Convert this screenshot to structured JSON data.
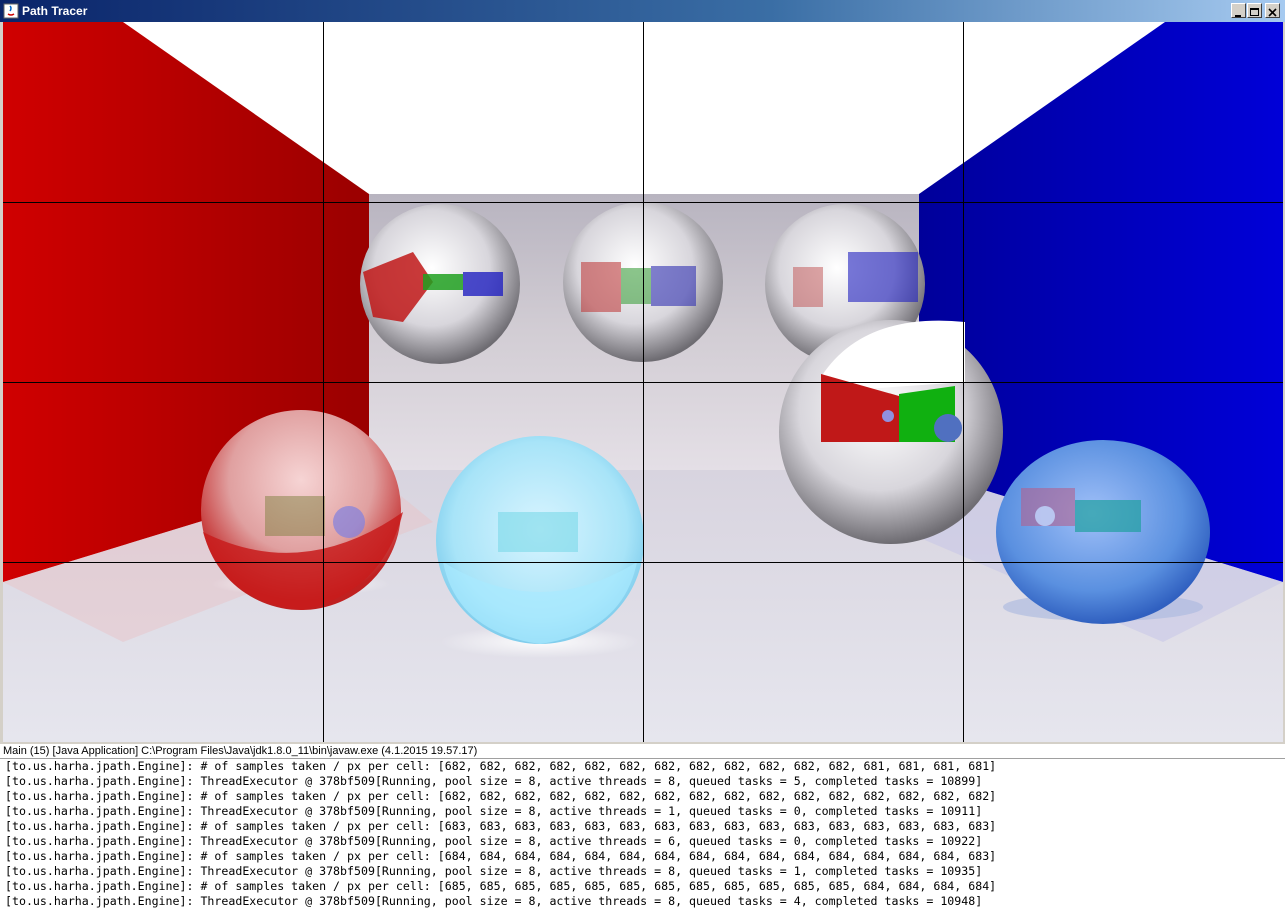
{
  "window": {
    "title": "Path Tracer",
    "buttons": [
      "minimize",
      "maximize",
      "close"
    ]
  },
  "render_view": {
    "grid_rows": 4,
    "grid_cols": 4,
    "colors": {
      "left_wall": "#cc0000",
      "right_wall": "#0000cc",
      "back_wall": "#c8c4d0",
      "floor": "#dcdbe6",
      "ceiling": "#ffffff",
      "grid_line": "#000000"
    }
  },
  "console": {
    "header": "Main (15) [Java Application] C:\\Program Files\\Java\\jdk1.8.0_11\\bin\\javaw.exe (4.1.2015 19.57.17)",
    "lines": [
      "[to.us.harha.jpath.Engine]: # of samples taken / px per cell: [682, 682, 682, 682, 682, 682, 682, 682, 682, 682, 682, 682, 681, 681, 681, 681]",
      "[to.us.harha.jpath.Engine]: ThreadExecutor @ 378bf509[Running, pool size = 8, active threads = 8, queued tasks = 5, completed tasks = 10899]",
      "[to.us.harha.jpath.Engine]: # of samples taken / px per cell: [682, 682, 682, 682, 682, 682, 682, 682, 682, 682, 682, 682, 682, 682, 682, 682]",
      "[to.us.harha.jpath.Engine]: ThreadExecutor @ 378bf509[Running, pool size = 8, active threads = 1, queued tasks = 0, completed tasks = 10911]",
      "[to.us.harha.jpath.Engine]: # of samples taken / px per cell: [683, 683, 683, 683, 683, 683, 683, 683, 683, 683, 683, 683, 683, 683, 683, 683]",
      "[to.us.harha.jpath.Engine]: ThreadExecutor @ 378bf509[Running, pool size = 8, active threads = 6, queued tasks = 0, completed tasks = 10922]",
      "[to.us.harha.jpath.Engine]: # of samples taken / px per cell: [684, 684, 684, 684, 684, 684, 684, 684, 684, 684, 684, 684, 684, 684, 684, 683]",
      "[to.us.harha.jpath.Engine]: ThreadExecutor @ 378bf509[Running, pool size = 8, active threads = 8, queued tasks = 1, completed tasks = 10935]",
      "[to.us.harha.jpath.Engine]: # of samples taken / px per cell: [685, 685, 685, 685, 685, 685, 685, 685, 685, 685, 685, 685, 684, 684, 684, 684]",
      "[to.us.harha.jpath.Engine]: ThreadExecutor @ 378bf509[Running, pool size = 8, active threads = 8, queued tasks = 4, completed tasks = 10948]"
    ]
  }
}
